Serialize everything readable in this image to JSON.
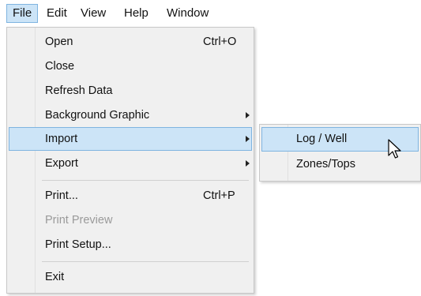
{
  "menubar": {
    "items": [
      "File",
      "Edit",
      "View",
      "Help",
      "Window"
    ],
    "active": "File"
  },
  "file_menu": {
    "items": [
      {
        "label": "Open",
        "shortcut": "Ctrl+O"
      },
      {
        "label": "Close"
      },
      {
        "label": "Refresh Data"
      },
      {
        "label": "Background Graphic",
        "submenu": true
      },
      {
        "label": "Import",
        "submenu": true,
        "highlighted": true
      },
      {
        "label": "Export",
        "submenu": true
      },
      {
        "label": "Print...",
        "shortcut": "Ctrl+P"
      },
      {
        "label": "Print Preview",
        "disabled": true
      },
      {
        "label": "Print Setup..."
      },
      {
        "label": "Exit"
      }
    ]
  },
  "import_submenu": {
    "items": [
      {
        "label": "Log / Well",
        "highlighted": true
      },
      {
        "label": "Zones/Tops"
      }
    ]
  },
  "colors": {
    "highlight_fill": "#cce4f7",
    "highlight_border": "#7fb4e0",
    "menu_background": "#f0f0f0",
    "disabled_text": "#9a9a9a"
  }
}
